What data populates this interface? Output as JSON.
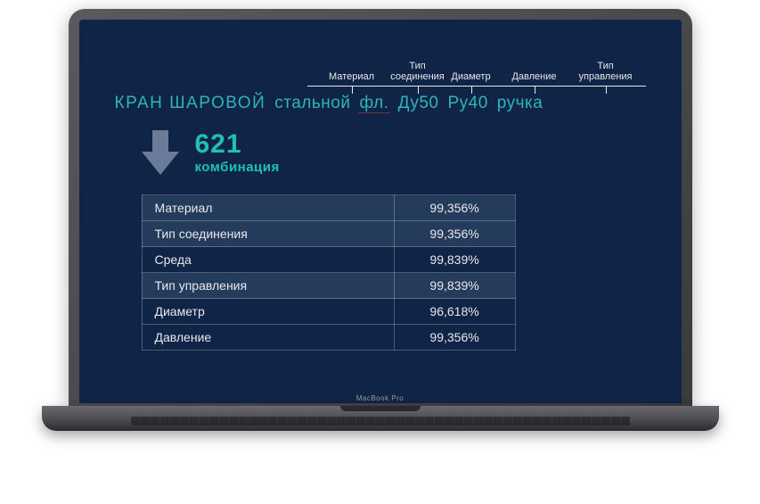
{
  "device_label": "MacBook Pro",
  "annotations": {
    "material": "Материал",
    "connection_type": "Тип\nсоединения",
    "diameter": "Диаметр",
    "pressure": "Давление",
    "control_type": "Тип\nуправления"
  },
  "title": {
    "main": "КРАН ШАРОВОЙ",
    "spec_material": "стальной",
    "spec_connection": "фл.",
    "spec_diameter": "Ду50",
    "spec_pressure": "Ру40",
    "spec_control": "ручка"
  },
  "combo": {
    "number": "621",
    "word": "комбинация"
  },
  "stats": [
    {
      "label": "Материал",
      "value": "99,356%",
      "highlight": true
    },
    {
      "label": "Тип соединения",
      "value": "99,356%",
      "highlight": true
    },
    {
      "label": "Среда",
      "value": "99,839%",
      "highlight": false
    },
    {
      "label": "Тип управления",
      "value": "99,839%",
      "highlight": true
    },
    {
      "label": "Диаметр",
      "value": "96,618%",
      "highlight": false
    },
    {
      "label": "Давление",
      "value": "99,356%",
      "highlight": false
    }
  ]
}
